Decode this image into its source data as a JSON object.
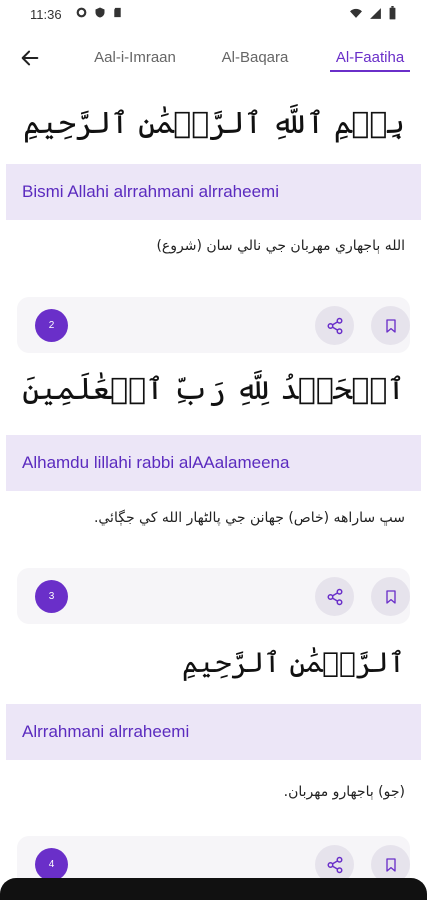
{
  "status": {
    "time": "11:36"
  },
  "tabs": [
    {
      "label": "Aal-i-Imraan",
      "active": false
    },
    {
      "label": "Al-Baqara",
      "active": false
    },
    {
      "label": "Al-Faatiha",
      "active": true
    }
  ],
  "accent_color": "#6a2fc9",
  "verses": [
    {
      "arabic": "بِسۡمِ ٱللَّهِ ٱلرَّحۡمَٰنِ ٱلرَّحِيمِ",
      "translit": "Bismi Allahi alrrahmani alrraheemi",
      "translation": "الله ٻاجهاري مهربان جي نالي سان (شروع)",
      "number": "2"
    },
    {
      "arabic": "ٱلۡحَمۡدُ لِلَّهِ رَبِّ ٱلۡعَٰلَمِينَ",
      "translit": "Alhamdu lillahi rabbi alAAalameena",
      "translation": "سڀ ساراهه (خاص) جهانن جي پالڻهار الله کي جڳائي.",
      "number": "3"
    },
    {
      "arabic": "ٱلرَّحۡمَٰنِ ٱلرَّحِيمِ",
      "translit": "Alrrahmani alrraheemi",
      "translation": "(جو) ٻاجهارو مهربان.",
      "number": "4"
    }
  ],
  "icons": {
    "back": "arrow-left-icon",
    "share": "share-icon",
    "bookmark": "bookmark-icon"
  }
}
